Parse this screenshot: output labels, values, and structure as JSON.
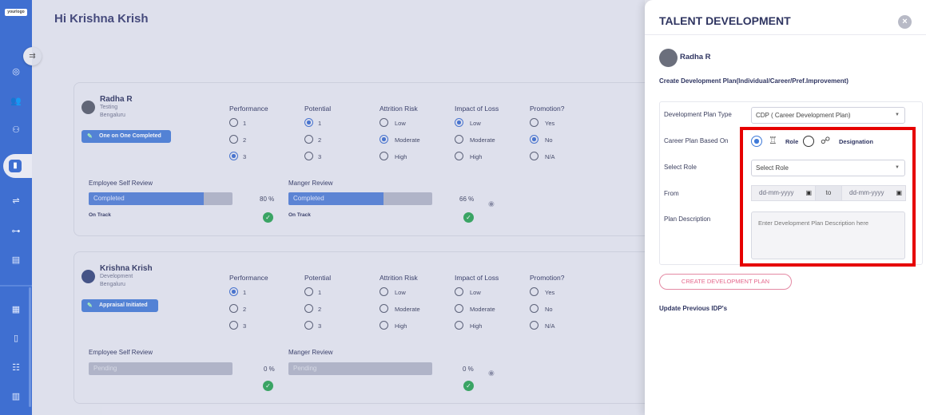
{
  "app": {
    "logo_text": "yourlogo"
  },
  "greeting": "Hi Krishna Krish",
  "employees": [
    {
      "name": "Radha R",
      "department": "Testing",
      "location": "Bengaluru",
      "status": "One on One Completed",
      "performance": "3",
      "potential": "1",
      "attrition_risk": "Moderate",
      "impact_of_loss": "Low",
      "promotion": "No",
      "self_review": {
        "label": "Employee Self Review",
        "status": "Completed",
        "percent_text": "80 %",
        "progress": 0.8,
        "track": "On Track"
      },
      "manager_review": {
        "label": "Manger Review",
        "status": "Completed",
        "percent_text": "66 %",
        "progress": 0.66,
        "track": "On Track"
      }
    },
    {
      "name": "Krishna Krish",
      "department": "Development",
      "location": "Bengaluru",
      "status": "Appraisal Initiated",
      "performance": "1",
      "potential": "",
      "attrition_risk": "",
      "impact_of_loss": "",
      "promotion": "",
      "self_review": {
        "label": "Employee Self Review",
        "status": "Pending",
        "percent_text": "0 %",
        "progress": 0,
        "track": ""
      },
      "manager_review": {
        "label": "Manger Review",
        "status": "Pending",
        "percent_text": "0 %",
        "progress": 0,
        "track": ""
      }
    }
  ],
  "columns": {
    "performance": {
      "label": "Performance",
      "options": [
        "1",
        "2",
        "3"
      ]
    },
    "potential": {
      "label": "Potential",
      "options": [
        "1",
        "2",
        "3"
      ]
    },
    "attrition_risk": {
      "label": "Attrition Risk",
      "options": [
        "Low",
        "Moderate",
        "High"
      ]
    },
    "impact_of_loss": {
      "label": "Impact of Loss",
      "options": [
        "Low",
        "Moderate",
        "High"
      ]
    },
    "promotion": {
      "label": "Promotion?",
      "options": [
        "Yes",
        "No",
        "N/A"
      ]
    }
  },
  "drawer": {
    "title": "TALENT DEVELOPMENT",
    "employee_name": "Radha R",
    "subtitle": "Create Development Plan(Individual/Career/Pref.Improvement)",
    "plan_type_label": "Development Plan Type",
    "plan_type_value": "CDP ( Career Development Plan)",
    "career_based_label": "Career Plan Based On",
    "role_option": "Role",
    "designation_option": "Designation",
    "select_role_label": "Select Role",
    "select_role_value": "Select Role",
    "from_label": "From",
    "date_placeholder": "dd-mm-yyyy",
    "to_label": "to",
    "plan_description_label": "Plan Description",
    "plan_description_placeholder": "Enter Development Plan Description here",
    "create_button": "CREATE DEVELOPMENT PLAN",
    "update_label": "Update Previous IDP's"
  },
  "colors": {
    "accent": "#3f6fd1",
    "highlight": "#e60000",
    "success": "#2ea558",
    "create_button": "#e5688d"
  }
}
